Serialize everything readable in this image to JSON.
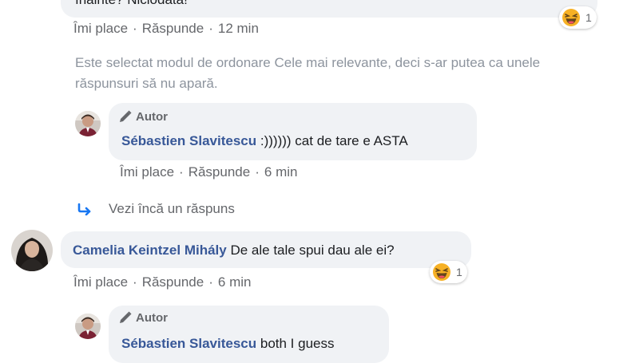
{
  "top_comment": {
    "text": "înainte? Niciodată!",
    "reaction_count": "1"
  },
  "top_meta": {
    "like": "Îmi place",
    "reply": "Răspunde",
    "time": "12 min"
  },
  "sort_notice": "Este selectat modul de ordonare Cele mai relevante, deci s-ar putea ca unele răspunsuri să nu apară.",
  "reply1": {
    "badge": "Autor",
    "author": "Sébastien Slavitescu",
    "text": ":)))))) cat de tare e ASTA",
    "like": "Îmi place",
    "reply": "Răspunde",
    "time": "6 min"
  },
  "more_replies": "Vezi încă un răspuns",
  "comment2": {
    "author": "Camelia Keintzel Mihály",
    "text": "De ale tale spui dau ale ei?",
    "reaction_count": "1",
    "like": "Îmi place",
    "reply": "Răspunde",
    "time": "6 min"
  },
  "reply2": {
    "badge": "Autor",
    "author": "Sébastien Slavitescu",
    "text": "both I guess"
  },
  "separator": "·",
  "icons": {
    "laugh": "laughing-emoji-icon",
    "pencil": "pencil-icon",
    "reply_arrow": "reply-arrow-icon"
  },
  "colors": {
    "bubble": "#f0f2f5",
    "name": "#385898",
    "meta": "#65676b",
    "notice": "#8d949e",
    "arrow": "#1877f2"
  }
}
